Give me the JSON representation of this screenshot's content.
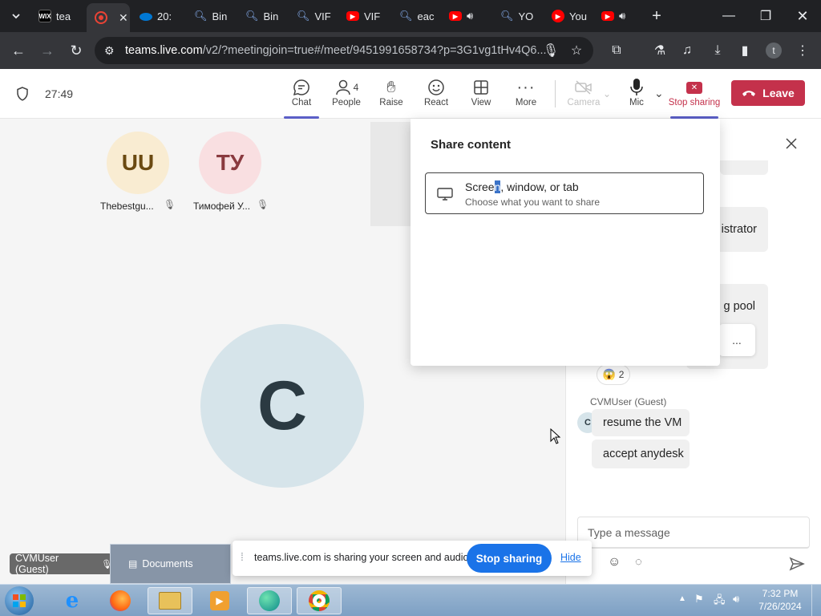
{
  "browser": {
    "tabs": [
      {
        "label": "tea",
        "icon": "wix-favicon",
        "color": "#000000"
      },
      {
        "label": "",
        "icon": "recording-favicon",
        "color": "#ea4335"
      },
      {
        "label": "20:",
        "icon": "onedrive-favicon",
        "color": "#0078d4"
      },
      {
        "label": "Bin",
        "icon": "search-favicon",
        "color": "#8ab4f8"
      },
      {
        "label": "Bin",
        "icon": "search-favicon",
        "color": "#8ab4f8"
      },
      {
        "label": "VIF",
        "icon": "search-favicon",
        "color": "#8ab4f8"
      },
      {
        "label": "VIF",
        "icon": "youtube-favicon",
        "color": "#ff0000"
      },
      {
        "label": "eac",
        "icon": "search-favicon",
        "color": "#8ab4f8"
      },
      {
        "label": "",
        "icon": "youtube-favicon",
        "color": "#ff0000"
      },
      {
        "label": "YO",
        "icon": "search-favicon",
        "color": "#8ab4f8"
      },
      {
        "label": "You",
        "icon": "youtube-music-favicon",
        "color": "#ff0000"
      },
      {
        "label": "",
        "icon": "youtube-favicon",
        "color": "#ff0000"
      }
    ],
    "url_host": "teams.live.com",
    "url_rest": "/v2/?meetingjoin=true#/meet/9451991658734?p=3G1vg1tHv4Q6...",
    "profile_initial": "t"
  },
  "teams": {
    "timer": "27:49",
    "toolbar": {
      "chat": "Chat",
      "people": "People",
      "people_count": "4",
      "raise": "Raise",
      "react": "React",
      "view": "View",
      "more": "More",
      "camera": "Camera",
      "mic": "Mic",
      "stop_sharing": "Stop sharing",
      "leave": "Leave"
    },
    "participants": [
      {
        "initials": "UU",
        "name": "Thebestgu...",
        "bg": "#f9ecd2",
        "fg": "#6b4a12"
      },
      {
        "initials": "ТУ",
        "name": "Тимофей У...",
        "bg": "#f9dfe1",
        "fg": "#8a3a3f"
      }
    ],
    "main_avatar": {
      "initial": "C",
      "bg": "#d6e4ea",
      "fg": "#2b3a42"
    },
    "self_label": "CVMUser (Guest)"
  },
  "share_panel": {
    "title": "Share content",
    "option_title_a": "Scree",
    "option_title_sel": "n",
    "option_title_b": ", window, or tab",
    "option_subtitle": "Choose what you want to share"
  },
  "chat": {
    "partial_1": "istrator",
    "partial_2": "g pool",
    "more_dots": "...",
    "reaction_count": "2",
    "sender": "CVMUser (Guest)",
    "sender_initial": "C",
    "messages": [
      "resume the VM",
      "accept anydesk"
    ],
    "compose_placeholder": "Type a message"
  },
  "sharing_bar": {
    "message": "teams.live.com is sharing your screen and audio.",
    "stop_button": "Stop sharing",
    "hide_link": "Hide"
  },
  "documents_tooltip": "Documents",
  "taskbar": {
    "time": "7:32 PM",
    "date": "7/26/2024"
  }
}
